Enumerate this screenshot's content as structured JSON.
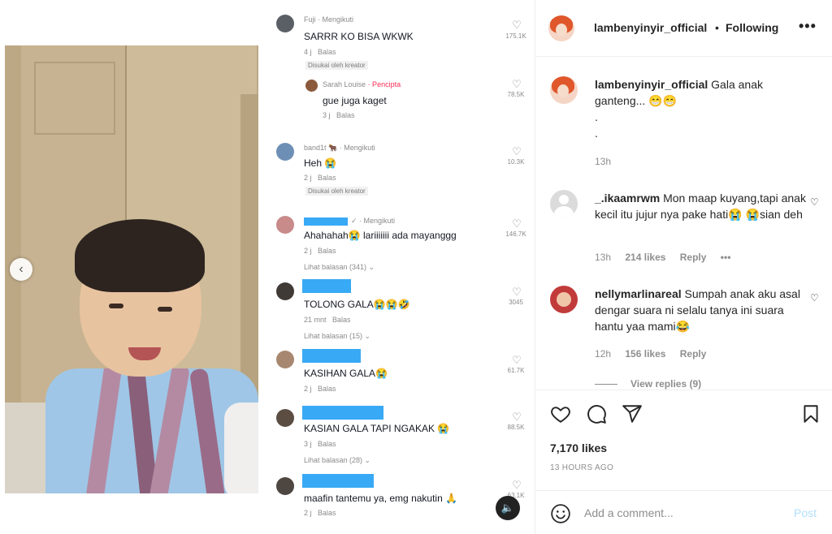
{
  "tiktok_comments": [
    {
      "user": "Fuji",
      "tag": "· Mengikuti",
      "text": "SARRR KO BISA WKWK",
      "time": "4 j",
      "reply": "Balas",
      "liked": "Disukai oleh kreator",
      "count": "175.1K"
    },
    {
      "user": "Sarah Louise",
      "tag": "· Pencipta",
      "text": "gue juga kaget",
      "time": "3 j",
      "reply": "Balas",
      "count": "78.5K"
    },
    {
      "user": "band1t 🐂",
      "tag": "· Mengikuti",
      "text": "Heh 😭",
      "time": "2 j",
      "reply": "Balas",
      "liked": "Disukai oleh kreator",
      "count": "10.3K"
    },
    {
      "tag": "✓ · Mengikuti",
      "text": "Ahahahah😭 lariiiiiii ada mayanggg",
      "time": "2 j",
      "reply": "Balas",
      "more": "Lihat balasan (341) ⌄",
      "count": "146.7K"
    },
    {
      "text": "TOLONG GALA😭😭🤣",
      "time": "21 mnt",
      "reply": "Balas",
      "more": "Lihat balasan (15) ⌄",
      "count": "3045"
    },
    {
      "text": "KASIHAN GALA😭",
      "time": "2 j",
      "reply": "Balas",
      "count": "61.7K"
    },
    {
      "text": "KASIAN GALA TAPI NGAKAK 😭",
      "time": "3 j",
      "reply": "Balas",
      "more": "Lihat balasan (28) ⌄",
      "count": "88.5K"
    },
    {
      "text": "maafin tantemu ya, emg nakutin 🙏",
      "time": "2 j",
      "reply": "Balas",
      "count": "63.1K"
    }
  ],
  "post": {
    "username": "lambenyinyir_official",
    "follow_label": "Following",
    "more_label": "•••",
    "caption_user": "lambenyinyir_official",
    "caption_text": "Gala anak ganteng... 😁😁",
    "caption_dot1": ".",
    "caption_dot2": ".",
    "caption_time": "13h",
    "likes": "7,170 likes",
    "time_ago": "13 HOURS AGO",
    "comment_placeholder": "Add a comment...",
    "post_label": "Post"
  },
  "comments": [
    {
      "user": "_.ikaamrwm",
      "text": "Mon maap kuyang,tapi anak kecil itu jujur nya pake hati😭 😭sian deh",
      "time": "13h",
      "likes": "214 likes",
      "reply": "Reply",
      "more": "•••"
    },
    {
      "user": "nellymarlinareal",
      "text": "Sumpah anak aku asal dengar suara ni selalu tanya ini suara hantu yaa mami😂",
      "time": "12h",
      "likes": "156 likes",
      "reply": "Reply",
      "view_replies": "View replies (9)"
    }
  ],
  "colors": {
    "accent": "#0095f6",
    "post_disabled": "#b2dffc",
    "tiktok_creator": "#fe2c55",
    "mask_blue": "#38a9f5"
  },
  "icons": [
    "chevron-left-icon",
    "heart-icon",
    "comment-icon",
    "share-icon",
    "bookmark-icon",
    "emoji-icon",
    "volume-icon",
    "more-icon"
  ]
}
